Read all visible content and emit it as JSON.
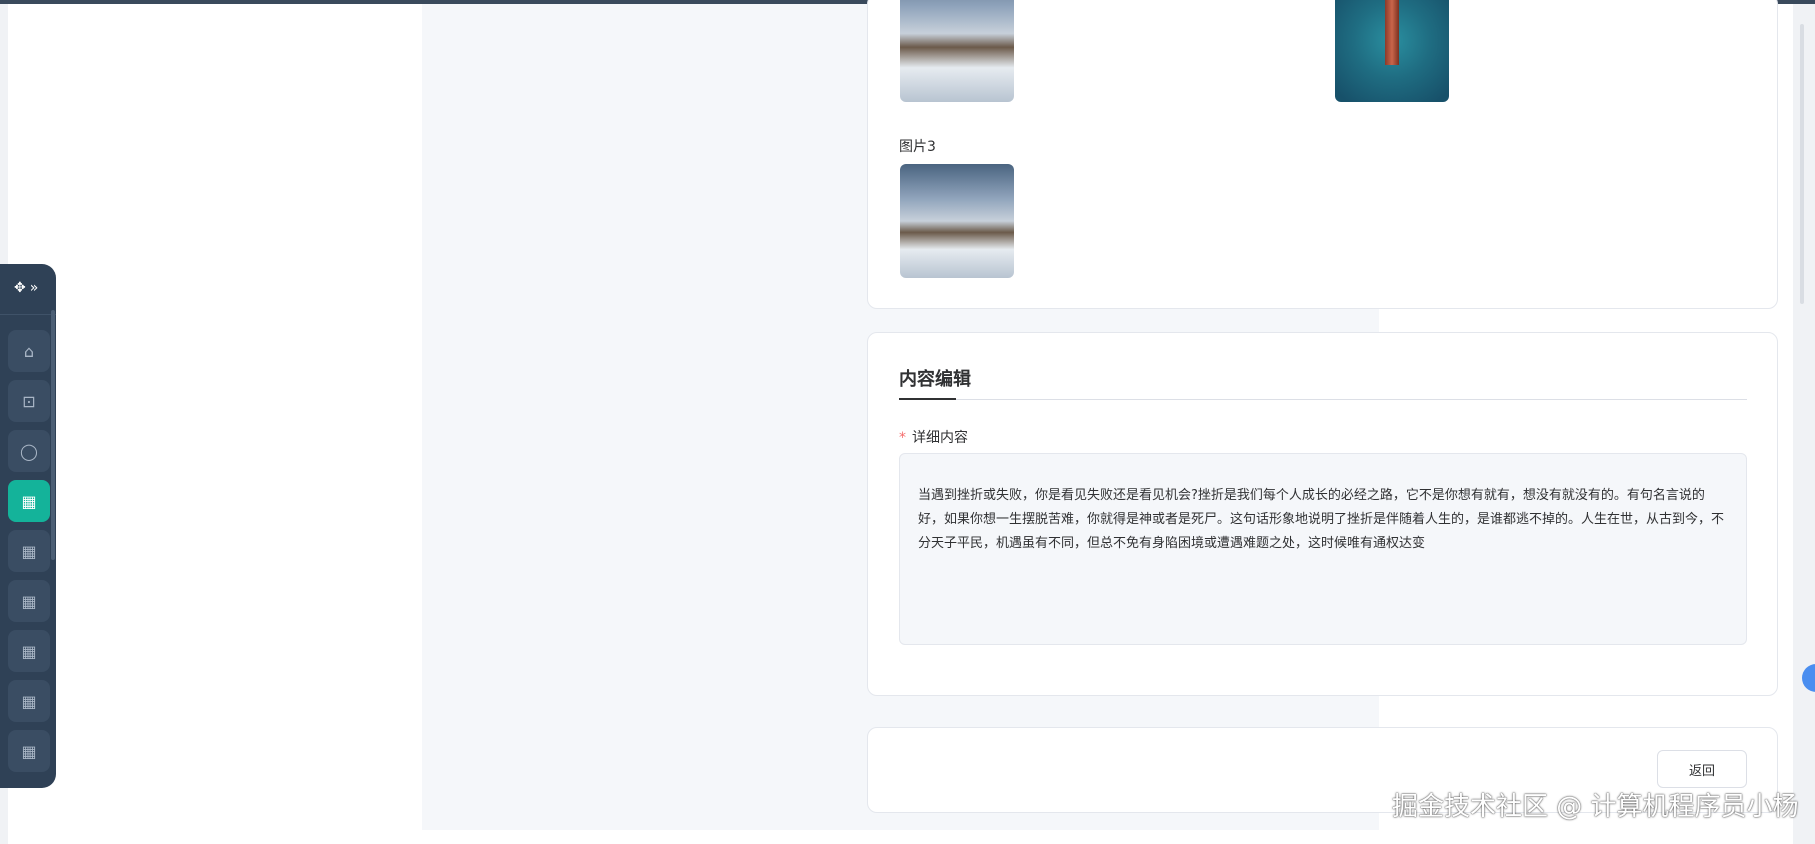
{
  "images_section": {
    "image3_label": "图片3"
  },
  "editor_section": {
    "title": "内容编辑",
    "field_required_mark": "*",
    "field_label": "详细内容",
    "content": "当遇到挫折或失败，你是看见失败还是看见机会?挫折是我们每个人成长的必经之路，它不是你想有就有，想没有就没有的。有句名言说的好，如果你想一生摆脱苦难，你就得是神或者是死尸。这句话形象地说明了挫折是伴随着人生的，是谁都逃不掉的。人生在世，从古到今，不分天子平民，机遇虽有不同，但总不免有身陷困境或遭遇难题之处，这时候唯有通权达变"
  },
  "actions": {
    "back_label": "返回"
  },
  "sidenav": {
    "top_icons": [
      "move-icon",
      "chevron-right-double-icon"
    ],
    "items": [
      {
        "icon": "home-icon",
        "glyph": "⌂"
      },
      {
        "icon": "lock-icon",
        "glyph": "🔒"
      },
      {
        "icon": "user-icon",
        "glyph": "👤"
      },
      {
        "icon": "grid-icon",
        "glyph": "▦",
        "active": true
      },
      {
        "icon": "grid-icon",
        "glyph": "▦"
      },
      {
        "icon": "grid-icon",
        "glyph": "▦"
      },
      {
        "icon": "grid-icon",
        "glyph": "▦"
      },
      {
        "icon": "grid-icon",
        "glyph": "▦"
      },
      {
        "icon": "grid-icon",
        "glyph": "▦"
      }
    ]
  },
  "watermark": "掘金技术社区 @ 计算机程序员小杨",
  "colors": {
    "accent": "#14b39a",
    "nav_bg": "#2f4156",
    "required": "#f56c6c"
  }
}
